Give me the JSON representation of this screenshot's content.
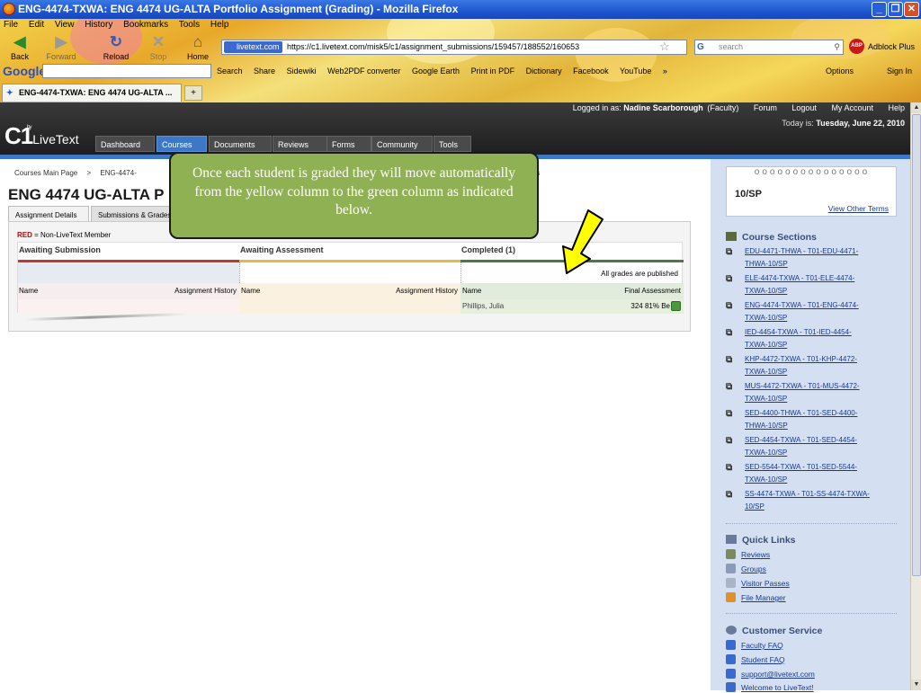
{
  "window": {
    "title": "ENG-4474-TXWA: ENG 4474 UG-ALTA Portfolio Assignment (Grading) - Mozilla Firefox",
    "minimize": "_",
    "restore": "❐",
    "close": "✕"
  },
  "menubar": [
    "File",
    "Edit",
    "View",
    "History",
    "Bookmarks",
    "Tools",
    "Help"
  ],
  "toolbar": {
    "back": "Back",
    "forward": "Forward",
    "reload": "Reload",
    "stop": "Stop",
    "home": "Home"
  },
  "urlbar": {
    "site": "livetext.com",
    "url": "https://c1.livetext.com/misk5/c1/assignment_submissions/159457/188552/160653"
  },
  "search": {
    "placeholder": "search",
    "engine": "G"
  },
  "adblock": {
    "badge": "ABP",
    "label": "Adblock Plus"
  },
  "google_bar": {
    "logo": "Google",
    "items": [
      "Search",
      "Share",
      "Sidewiki",
      "Web2PDF converter",
      "Google Earth",
      "Print in PDF",
      "Dictionary",
      "Facebook",
      "YouTube",
      "»"
    ],
    "options": "Options",
    "signin": "Sign In"
  },
  "tab": {
    "label": "ENG-4474-TXWA: ENG 4474 UG-ALTA ...",
    "new": "+"
  },
  "app": {
    "logo_c1": "C1",
    "logo_by": "by",
    "logo_text": "LiveText",
    "logged_in_label": "Logged in as:",
    "user": "Nadine Scarborough",
    "role": "(Faculty)",
    "links": [
      "Forum",
      "Logout",
      "My Account",
      "Help"
    ],
    "today_label": "Today is:",
    "today": "Tuesday, June 22, 2010",
    "tabs": [
      "Dashboard",
      "Courses",
      "Documents",
      "Reviews",
      "Forms",
      "Community",
      "Tools"
    ]
  },
  "breadcrumb": [
    "Courses Main Page",
    ">",
    "ENG-4474-"
  ],
  "breadcrumb_tail": "ts",
  "page": {
    "title": "ENG 4474 UG-ALTA P",
    "subtabs": [
      "Assignment Details",
      "Submissions & Grades"
    ],
    "legend_red": "RED",
    "legend_text": "= Non-LiveText Member"
  },
  "columns": {
    "awaiting_submission": "Awaiting Submission",
    "awaiting_assessment": "Awaiting Assessment",
    "completed": "Completed (1)",
    "all_published": "All grades are published",
    "name": "Name",
    "assignment_history": "Assignment History",
    "final_assessment": "Final Assessment"
  },
  "completed_row": {
    "name": "Phillips, Julia",
    "grade": "324 81% Be"
  },
  "colors": {
    "red_bar": "#c0392b",
    "yellow_bar": "#e8b84a",
    "green_bar": "#4a7a48",
    "callout": "#8fb153",
    "accent_blue": "#3d78c8"
  },
  "callout": "Once each student is graded they will move automatically from the yellow column to the green column as indicated below.",
  "sidebar": {
    "term": "10/SP",
    "other_terms": "View Other Terms",
    "course_sections_title": "Course Sections",
    "sections": [
      "EDU-4471-THWA - T01-EDU-4471-THWA-10/SP",
      "ELE-4474-TXWA - T01-ELE-4474-TXWA-10/SP",
      "ENG-4474-TXWA - T01-ENG-4474-TXWA-10/SP",
      "IED-4454-TXWA - T01-IED-4454-TXWA-10/SP",
      "KHP-4472-TXWA - T01-KHP-4472-TXWA-10/SP",
      "MUS-4472-TXWA - T01-MUS-4472-TXWA-10/SP",
      "SED-4400-THWA - T01-SED-4400-THWA-10/SP",
      "SED-4454-TXWA - T01-SED-4454-TXWA-10/SP",
      "SED-5544-TXWA - T01-SED-5544-TXWA-10/SP",
      "SS-4474-TXWA - T01-SS-4474-TXWA-10/SP"
    ],
    "quick_links_title": "Quick Links",
    "quick_links": [
      "Reviews",
      "Groups",
      "Visitor Passes",
      "File Manager"
    ],
    "customer_service_title": "Customer Service",
    "customer_service": [
      "Faculty FAQ",
      "Student FAQ",
      "support@livetext.com",
      "Welcome to LiveText!"
    ]
  }
}
